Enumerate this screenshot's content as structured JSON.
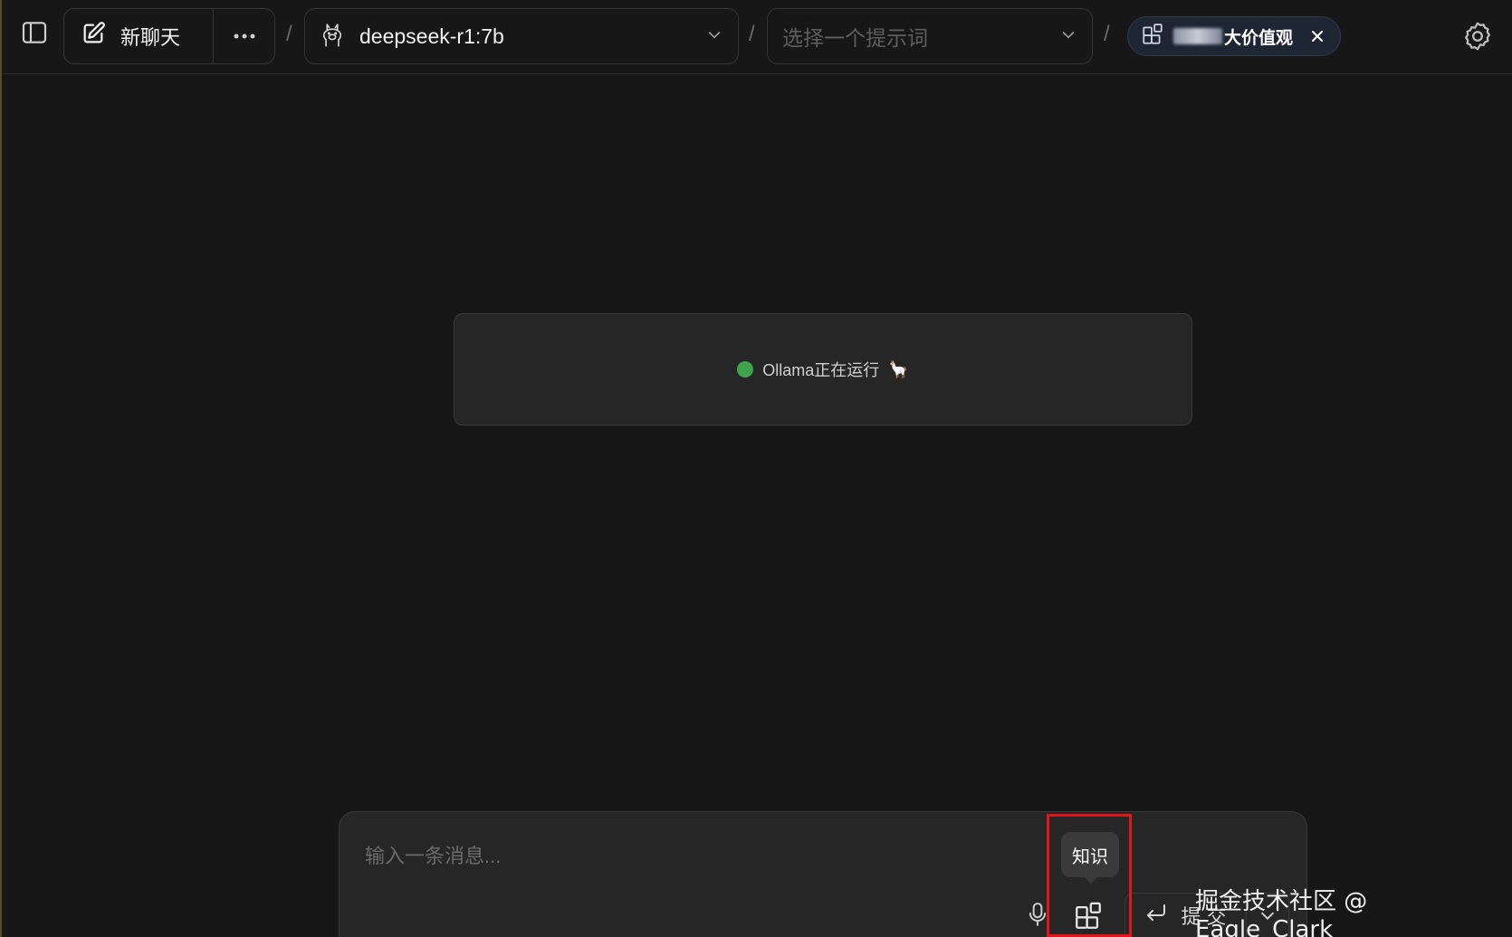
{
  "header": {
    "new_chat_label": "新聊天",
    "separator": "/",
    "model": {
      "label": "deepseek-r1:7b"
    },
    "prompt": {
      "placeholder": "选择一个提示词"
    },
    "knowledge_chip": {
      "label": "大价值观"
    }
  },
  "status": {
    "text": "Ollama正在运行",
    "emoji": "🦙"
  },
  "composer": {
    "placeholder": "输入一条消息...",
    "tooltip": "知识",
    "submit_label": "提 交"
  },
  "watermark": "掘金技术社区 @ Eagle_Clark",
  "colors": {
    "status_dot": "#3fa34d",
    "highlight": "#e0161b",
    "chip_bg": "#1e2533"
  }
}
